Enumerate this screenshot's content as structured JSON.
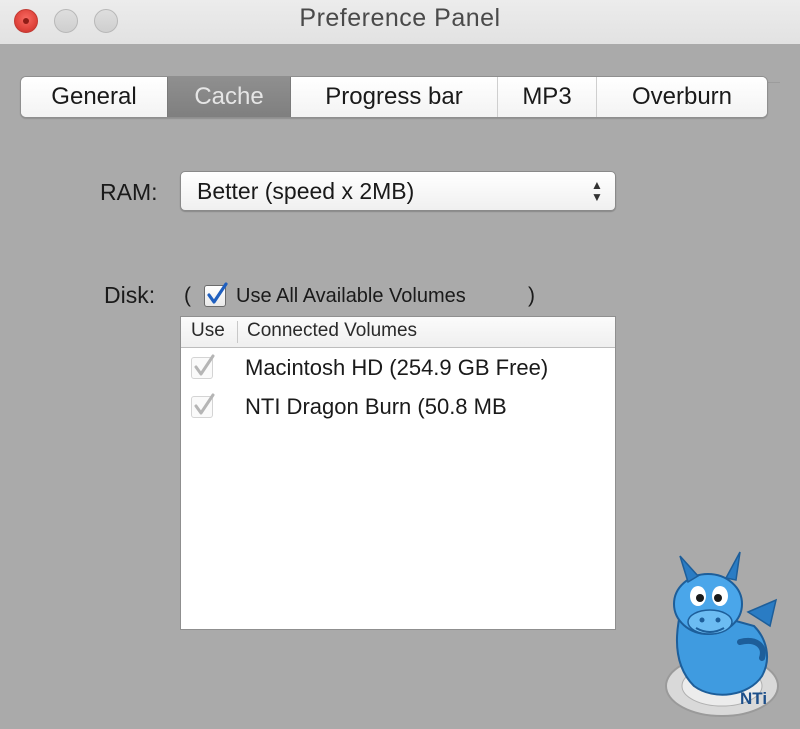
{
  "window": {
    "title": "Preference Panel"
  },
  "tabs": [
    {
      "label": "General",
      "active": false
    },
    {
      "label": "Cache",
      "active": true
    },
    {
      "label": "Progress bar",
      "active": false
    },
    {
      "label": "MP3",
      "active": false
    },
    {
      "label": "Overburn",
      "active": false
    }
  ],
  "ram": {
    "label": "RAM:",
    "selected": "Better (speed x 2MB)"
  },
  "disk": {
    "label": "Disk:",
    "paren_open": "(",
    "paren_close": ")",
    "use_all_label": "Use All Available Volumes",
    "use_all_checked": true
  },
  "volumes": {
    "columns": {
      "use": "Use",
      "name": "Connected Volumes"
    },
    "rows": [
      {
        "name": "Macintosh HD (254.9 GB Free)",
        "checked": true,
        "enabled": false
      },
      {
        "name": "NTI Dragon Burn (50.8 MB",
        "checked": true,
        "enabled": false
      }
    ]
  },
  "logo": {
    "text": "NTi",
    "icon": "nti-dragon-logo-icon"
  },
  "colors": {
    "close_button": "#e0443c",
    "panel_background": "#aaaaaa",
    "active_tab": "#878787",
    "checkmark": "#1f5fbf",
    "disabled_checkmark": "#b5b5b5",
    "logo_blue": "#3f9be0"
  }
}
